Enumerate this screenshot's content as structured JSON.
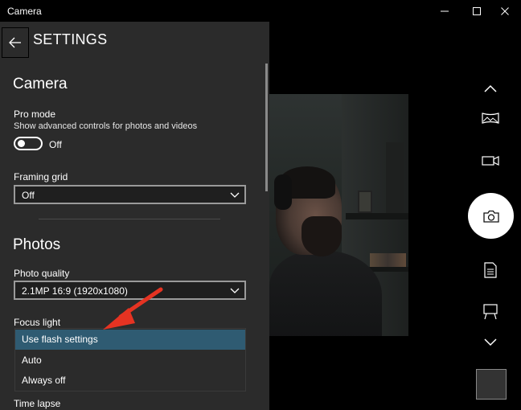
{
  "window": {
    "title": "Camera",
    "controls": [
      "minimize-icon",
      "maximize-icon",
      "close-icon"
    ]
  },
  "settings": {
    "title": "SETTINGS",
    "camera_section": {
      "title": "Camera",
      "pro_mode": {
        "label": "Pro mode",
        "description": "Show advanced controls for photos and videos",
        "toggle_state": "Off"
      },
      "framing_grid": {
        "label": "Framing grid",
        "value": "Off"
      }
    },
    "photos_section": {
      "title": "Photos",
      "photo_quality": {
        "label": "Photo quality",
        "value": "2.1MP 16:9 (1920x1080)"
      },
      "focus_light": {
        "label": "Focus light",
        "options": [
          "Use flash settings",
          "Auto",
          "Always off"
        ],
        "selected": "Use flash settings"
      },
      "time_lapse": {
        "label": "Time lapse"
      }
    }
  },
  "camera_controls": {
    "icons": [
      "chevron-up-icon",
      "panorama-icon",
      "video-icon",
      "camera-icon",
      "document-icon",
      "whiteboard-icon",
      "chevron-down-icon"
    ]
  },
  "colors": {
    "panel_bg": "#2b2b2b",
    "selected_item": "#2f5b72",
    "annotation_arrow": "#e53322"
  }
}
